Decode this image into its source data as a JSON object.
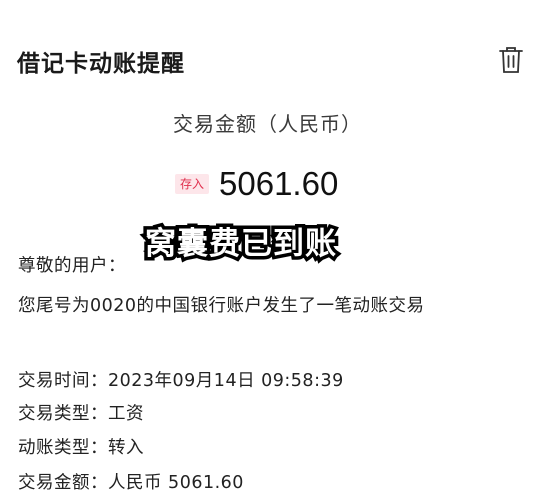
{
  "header": {
    "title": "借记卡动账提醒",
    "delete_icon": "trash-icon"
  },
  "transaction": {
    "amount_label": "交易金额（人民币）",
    "badge": "存入",
    "amount": "5061.60"
  },
  "overlay_caption": "窝囊费已到账",
  "message": {
    "greeting": "尊敬的用户：",
    "body": "您尾号为0020的中国银行账户发生了一笔动账交易",
    "fields": [
      "交易时间：2023年09月14日 09:58:39",
      "交易类型：工资",
      "动账类型：转入",
      "交易金额：人民币 5061.60"
    ]
  },
  "colors": {
    "badge_bg": "#fde6ea",
    "badge_text": "#e0304e"
  }
}
